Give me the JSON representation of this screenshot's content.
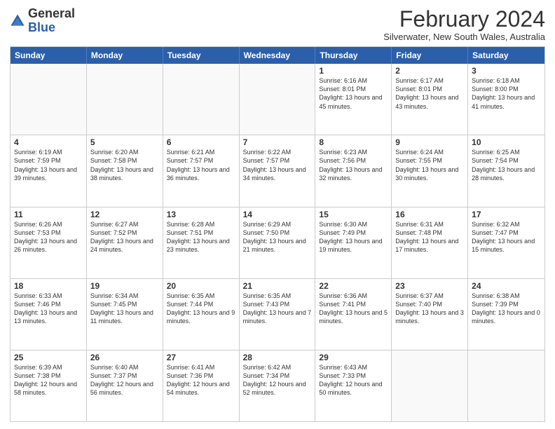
{
  "logo": {
    "general": "General",
    "blue": "Blue"
  },
  "title": "February 2024",
  "subtitle": "Silverwater, New South Wales, Australia",
  "headers": [
    "Sunday",
    "Monday",
    "Tuesday",
    "Wednesday",
    "Thursday",
    "Friday",
    "Saturday"
  ],
  "rows": [
    [
      {
        "day": "",
        "info": ""
      },
      {
        "day": "",
        "info": ""
      },
      {
        "day": "",
        "info": ""
      },
      {
        "day": "",
        "info": ""
      },
      {
        "day": "1",
        "info": "Sunrise: 6:16 AM\nSunset: 8:01 PM\nDaylight: 13 hours and 45 minutes."
      },
      {
        "day": "2",
        "info": "Sunrise: 6:17 AM\nSunset: 8:01 PM\nDaylight: 13 hours and 43 minutes."
      },
      {
        "day": "3",
        "info": "Sunrise: 6:18 AM\nSunset: 8:00 PM\nDaylight: 13 hours and 41 minutes."
      }
    ],
    [
      {
        "day": "4",
        "info": "Sunrise: 6:19 AM\nSunset: 7:59 PM\nDaylight: 13 hours and 39 minutes."
      },
      {
        "day": "5",
        "info": "Sunrise: 6:20 AM\nSunset: 7:58 PM\nDaylight: 13 hours and 38 minutes."
      },
      {
        "day": "6",
        "info": "Sunrise: 6:21 AM\nSunset: 7:57 PM\nDaylight: 13 hours and 36 minutes."
      },
      {
        "day": "7",
        "info": "Sunrise: 6:22 AM\nSunset: 7:57 PM\nDaylight: 13 hours and 34 minutes."
      },
      {
        "day": "8",
        "info": "Sunrise: 6:23 AM\nSunset: 7:56 PM\nDaylight: 13 hours and 32 minutes."
      },
      {
        "day": "9",
        "info": "Sunrise: 6:24 AM\nSunset: 7:55 PM\nDaylight: 13 hours and 30 minutes."
      },
      {
        "day": "10",
        "info": "Sunrise: 6:25 AM\nSunset: 7:54 PM\nDaylight: 13 hours and 28 minutes."
      }
    ],
    [
      {
        "day": "11",
        "info": "Sunrise: 6:26 AM\nSunset: 7:53 PM\nDaylight: 13 hours and 26 minutes."
      },
      {
        "day": "12",
        "info": "Sunrise: 6:27 AM\nSunset: 7:52 PM\nDaylight: 13 hours and 24 minutes."
      },
      {
        "day": "13",
        "info": "Sunrise: 6:28 AM\nSunset: 7:51 PM\nDaylight: 13 hours and 23 minutes."
      },
      {
        "day": "14",
        "info": "Sunrise: 6:29 AM\nSunset: 7:50 PM\nDaylight: 13 hours and 21 minutes."
      },
      {
        "day": "15",
        "info": "Sunrise: 6:30 AM\nSunset: 7:49 PM\nDaylight: 13 hours and 19 minutes."
      },
      {
        "day": "16",
        "info": "Sunrise: 6:31 AM\nSunset: 7:48 PM\nDaylight: 13 hours and 17 minutes."
      },
      {
        "day": "17",
        "info": "Sunrise: 6:32 AM\nSunset: 7:47 PM\nDaylight: 13 hours and 15 minutes."
      }
    ],
    [
      {
        "day": "18",
        "info": "Sunrise: 6:33 AM\nSunset: 7:46 PM\nDaylight: 13 hours and 13 minutes."
      },
      {
        "day": "19",
        "info": "Sunrise: 6:34 AM\nSunset: 7:45 PM\nDaylight: 13 hours and 11 minutes."
      },
      {
        "day": "20",
        "info": "Sunrise: 6:35 AM\nSunset: 7:44 PM\nDaylight: 13 hours and 9 minutes."
      },
      {
        "day": "21",
        "info": "Sunrise: 6:35 AM\nSunset: 7:43 PM\nDaylight: 13 hours and 7 minutes."
      },
      {
        "day": "22",
        "info": "Sunrise: 6:36 AM\nSunset: 7:41 PM\nDaylight: 13 hours and 5 minutes."
      },
      {
        "day": "23",
        "info": "Sunrise: 6:37 AM\nSunset: 7:40 PM\nDaylight: 13 hours and 3 minutes."
      },
      {
        "day": "24",
        "info": "Sunrise: 6:38 AM\nSunset: 7:39 PM\nDaylight: 13 hours and 0 minutes."
      }
    ],
    [
      {
        "day": "25",
        "info": "Sunrise: 6:39 AM\nSunset: 7:38 PM\nDaylight: 12 hours and 58 minutes."
      },
      {
        "day": "26",
        "info": "Sunrise: 6:40 AM\nSunset: 7:37 PM\nDaylight: 12 hours and 56 minutes."
      },
      {
        "day": "27",
        "info": "Sunrise: 6:41 AM\nSunset: 7:36 PM\nDaylight: 12 hours and 54 minutes."
      },
      {
        "day": "28",
        "info": "Sunrise: 6:42 AM\nSunset: 7:34 PM\nDaylight: 12 hours and 52 minutes."
      },
      {
        "day": "29",
        "info": "Sunrise: 6:43 AM\nSunset: 7:33 PM\nDaylight: 12 hours and 50 minutes."
      },
      {
        "day": "",
        "info": ""
      },
      {
        "day": "",
        "info": ""
      }
    ]
  ]
}
